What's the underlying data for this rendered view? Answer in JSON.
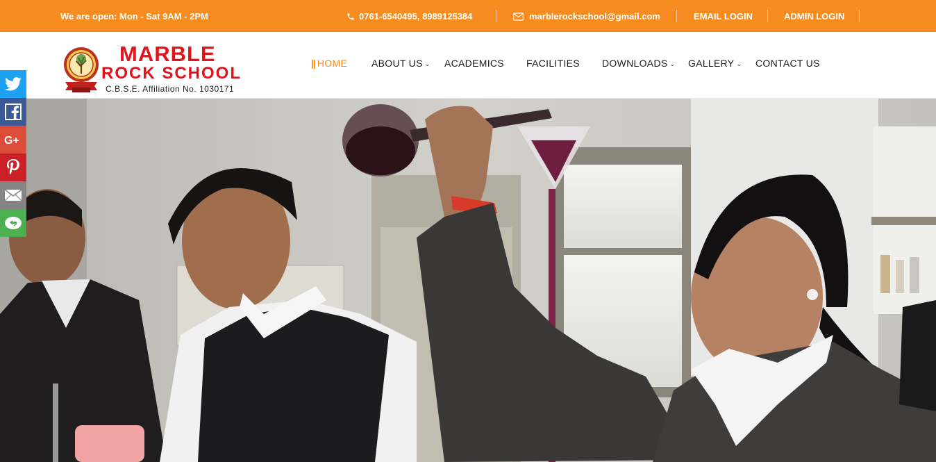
{
  "topbar": {
    "hours": "We are open: Mon - Sat 9AM - 2PM",
    "phone": "0761-6540495, 8989125384",
    "email": "marblerockschool@gmail.com",
    "email_login": "EMAIL LOGIN",
    "admin_login": "ADMIN LOGIN"
  },
  "logo": {
    "title_line1": "MARBLE",
    "title_line2": "ROCK SCHOOL",
    "affiliation": "C.B.S.E. Affiliation No. 1030171"
  },
  "nav": {
    "items": [
      {
        "label": "HOME",
        "active": true
      },
      {
        "label": "ABOUT US",
        "dropdown": true
      },
      {
        "label": "ACADEMICS"
      },
      {
        "label": "FACILITIES"
      },
      {
        "label": "DOWNLOADS",
        "dropdown": true
      },
      {
        "label": "GALLERY",
        "dropdown": true
      },
      {
        "label": "CONTACT US"
      }
    ]
  },
  "social": [
    {
      "icon": "twitter-icon",
      "color": "#1da1f2"
    },
    {
      "icon": "facebook-icon",
      "color": "#3b5998"
    },
    {
      "icon": "google-plus-icon",
      "color": "#dd4b39"
    },
    {
      "icon": "pinterest-icon",
      "color": "#cb2027"
    },
    {
      "icon": "email-icon",
      "color": "#848484"
    },
    {
      "icon": "more-share-icon",
      "color": "#4caf50"
    }
  ],
  "hero": {
    "image": "students-chemistry-lab-photo"
  },
  "colors": {
    "accent": "#f68b1f",
    "brand_red": "#e1141b"
  }
}
